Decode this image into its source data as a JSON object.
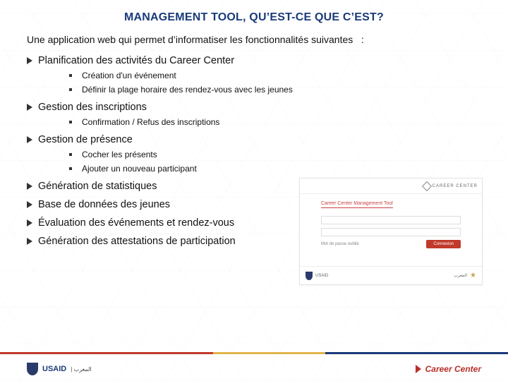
{
  "title": "MANAGEMENT TOOL, QU’EST-CE QUE C’EST?",
  "intro": "Une application web qui permet d’informatiser les fonctionnalités suivantes   :",
  "sections": [
    {
      "label": "Planification des activités du Career Center",
      "items": [
        "Création d'un événement",
        "Définir la plage horaire des rendez-vous avec les jeunes"
      ]
    },
    {
      "label": "Gestion des inscriptions",
      "items": [
        "Confirmation / Refus  des inscriptions"
      ]
    },
    {
      "label": "Gestion de présence",
      "items": [
        "Cocher les présents",
        "Ajouter un nouveau participant"
      ]
    },
    {
      "label": "Génération de statistiques",
      "items": []
    },
    {
      "label": "Base de données des jeunes",
      "items": []
    },
    {
      "label": "Évaluation des événements et rendez-vous",
      "items": []
    },
    {
      "label": "Génération des attestations de participation",
      "items": []
    }
  ],
  "screenshot": {
    "brand": "CAREER CENTER",
    "tab": "Career Center Management Tool",
    "button": "Connexion",
    "forgot": "Mot de passe oublié",
    "footer_left": "USAID",
    "footer_right": "المغرب"
  },
  "footer": {
    "left": "USAID",
    "left_ar": "| المغرب",
    "right": "Career Center"
  }
}
